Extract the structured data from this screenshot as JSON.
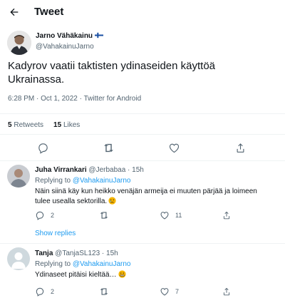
{
  "header": {
    "title": "Tweet",
    "back_icon": "arrow-left-icon"
  },
  "tweet": {
    "author_name": "Jarno Vähäkainu",
    "author_handle": "@VahakainuJarno",
    "flag_icon": "finland-flag-icon",
    "text": "Kadyrov vaatii taktisten ydinaseiden käyttöä Ukrainassa.",
    "time": "6:28 PM",
    "date": "Oct 1, 2022",
    "source": "Twitter for Android",
    "retweets_count": "5",
    "retweets_label": "Retweets",
    "likes_count": "15",
    "likes_label": "Likes",
    "actions": [
      "reply-icon",
      "retweet-icon",
      "like-icon",
      "share-icon"
    ]
  },
  "replies": [
    {
      "name": "Juha Virrankari",
      "handle": "@Jerbabaa",
      "time": "15h",
      "replying_prefix": "Replying to",
      "replying_to": "@VahakainuJarno",
      "text": "Näin siinä käy kun heikko venäjän armeija ei muuten pärjää ja loimeen tulee usealla sektorilla.",
      "emoji": "sad-face-emoji",
      "reply_count": "2",
      "retweet_count": "",
      "like_count": "11",
      "show_replies": "Show replies"
    },
    {
      "name": "Tanja",
      "handle": "@TanjaSL123",
      "time": "15h",
      "replying_prefix": "Replying to",
      "replying_to": "@VahakainuJarno",
      "text": "Ydinaseet pitäisi kieltää…",
      "emoji": "grimacing-face-emoji",
      "reply_count": "2",
      "retweet_count": "",
      "like_count": "7"
    }
  ],
  "colors": {
    "accent": "#1d9bf0",
    "text": "#0f1419",
    "muted": "#536471",
    "divider": "#eff3f4"
  }
}
